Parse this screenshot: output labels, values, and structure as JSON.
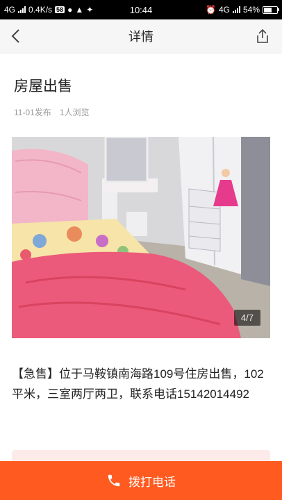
{
  "status_bar": {
    "network": "4G",
    "speed": "0.4K/s",
    "badge": "58",
    "time": "10:44",
    "network_right": "4G",
    "battery": "54%"
  },
  "nav": {
    "title": "详情",
    "back_icon": "chevron-left-icon",
    "share_icon": "share-icon"
  },
  "listing": {
    "title": "房屋出售",
    "date": "11-01发布",
    "views": "1人浏览"
  },
  "gallery": {
    "counter": "4/7",
    "current": 4,
    "total": 7
  },
  "description": "【急售】位于马鞍镇南海路109号住房出售，102平米，三室两厅两卫，联系电话15142014492",
  "footer": {
    "call_label": "拨打电话",
    "call_icon": "phone-icon",
    "accent": "#ff5a1f"
  }
}
